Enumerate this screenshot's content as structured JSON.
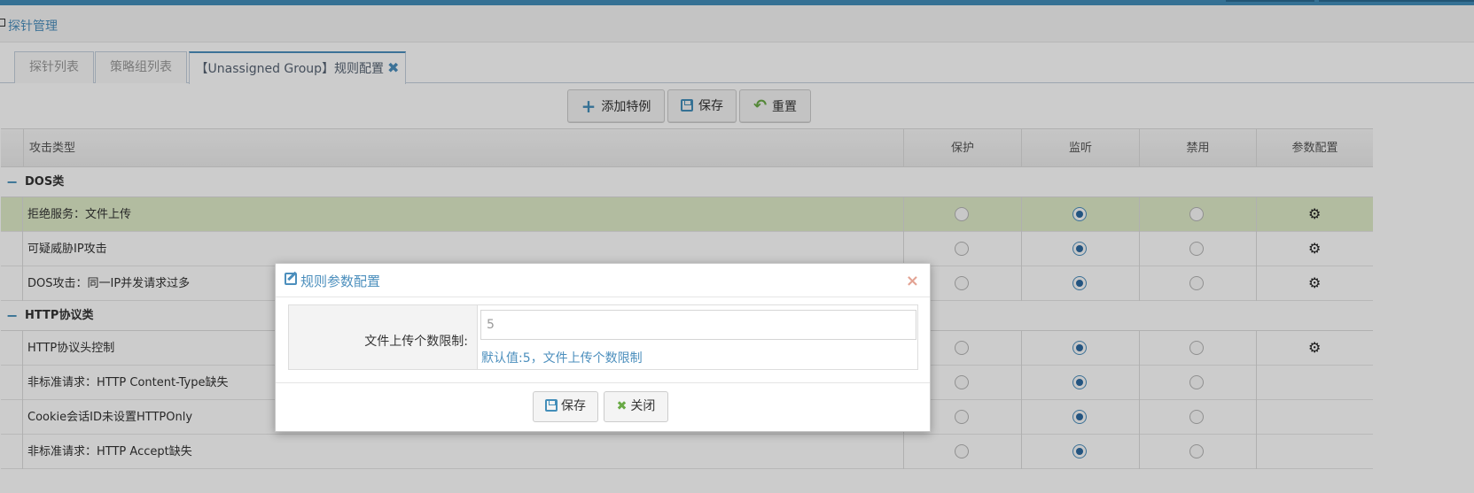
{
  "breadcrumb": {
    "label": "探针管理"
  },
  "tabs": [
    {
      "label": "探针列表"
    },
    {
      "label": "策略组列表"
    },
    {
      "label": "【Unassigned Group】规则配置",
      "close": "✖"
    }
  ],
  "toolbar": {
    "add_label": "添加特例",
    "save_label": "保存",
    "reset_label": "重置"
  },
  "table": {
    "columns": [
      "攻击类型",
      "保护",
      "监听",
      "禁用",
      "参数配置"
    ],
    "groups": [
      {
        "label": "DOS类",
        "toggle": "−"
      },
      {
        "label": "HTTP协议类",
        "toggle": "−"
      }
    ],
    "rows": [
      {
        "name": "拒绝服务：文件上传",
        "mode": "监听",
        "has_config": true,
        "highlighted": true
      },
      {
        "name": "可疑威胁IP攻击",
        "mode": "监听",
        "has_config": true
      },
      {
        "name": "DOS攻击：同一IP并发请求过多",
        "mode": "监听",
        "has_config": true
      },
      {
        "name": "HTTP协议头控制",
        "mode": "监听",
        "has_config": true
      },
      {
        "name": "非标准请求：HTTP Content-Type缺失",
        "mode": "监听",
        "has_config": false
      },
      {
        "name": "Cookie会话ID未设置HTTPOnly",
        "mode": "监听",
        "has_config": false
      },
      {
        "name": "非标准请求：HTTP Accept缺失",
        "mode": "监听",
        "has_config": false
      }
    ]
  },
  "modal": {
    "title": "规则参数配置",
    "close": "×",
    "field_label": "文件上传个数限制:",
    "field_value": "5",
    "hint": "默认值:5，文件上传个数限制",
    "save_label": "保存",
    "close_label": "关闭"
  },
  "colors": {
    "accent": "#438eb9",
    "link": "#4c8fbd",
    "highlight_row": "#dfecc8",
    "close_green": "#69aa46"
  }
}
